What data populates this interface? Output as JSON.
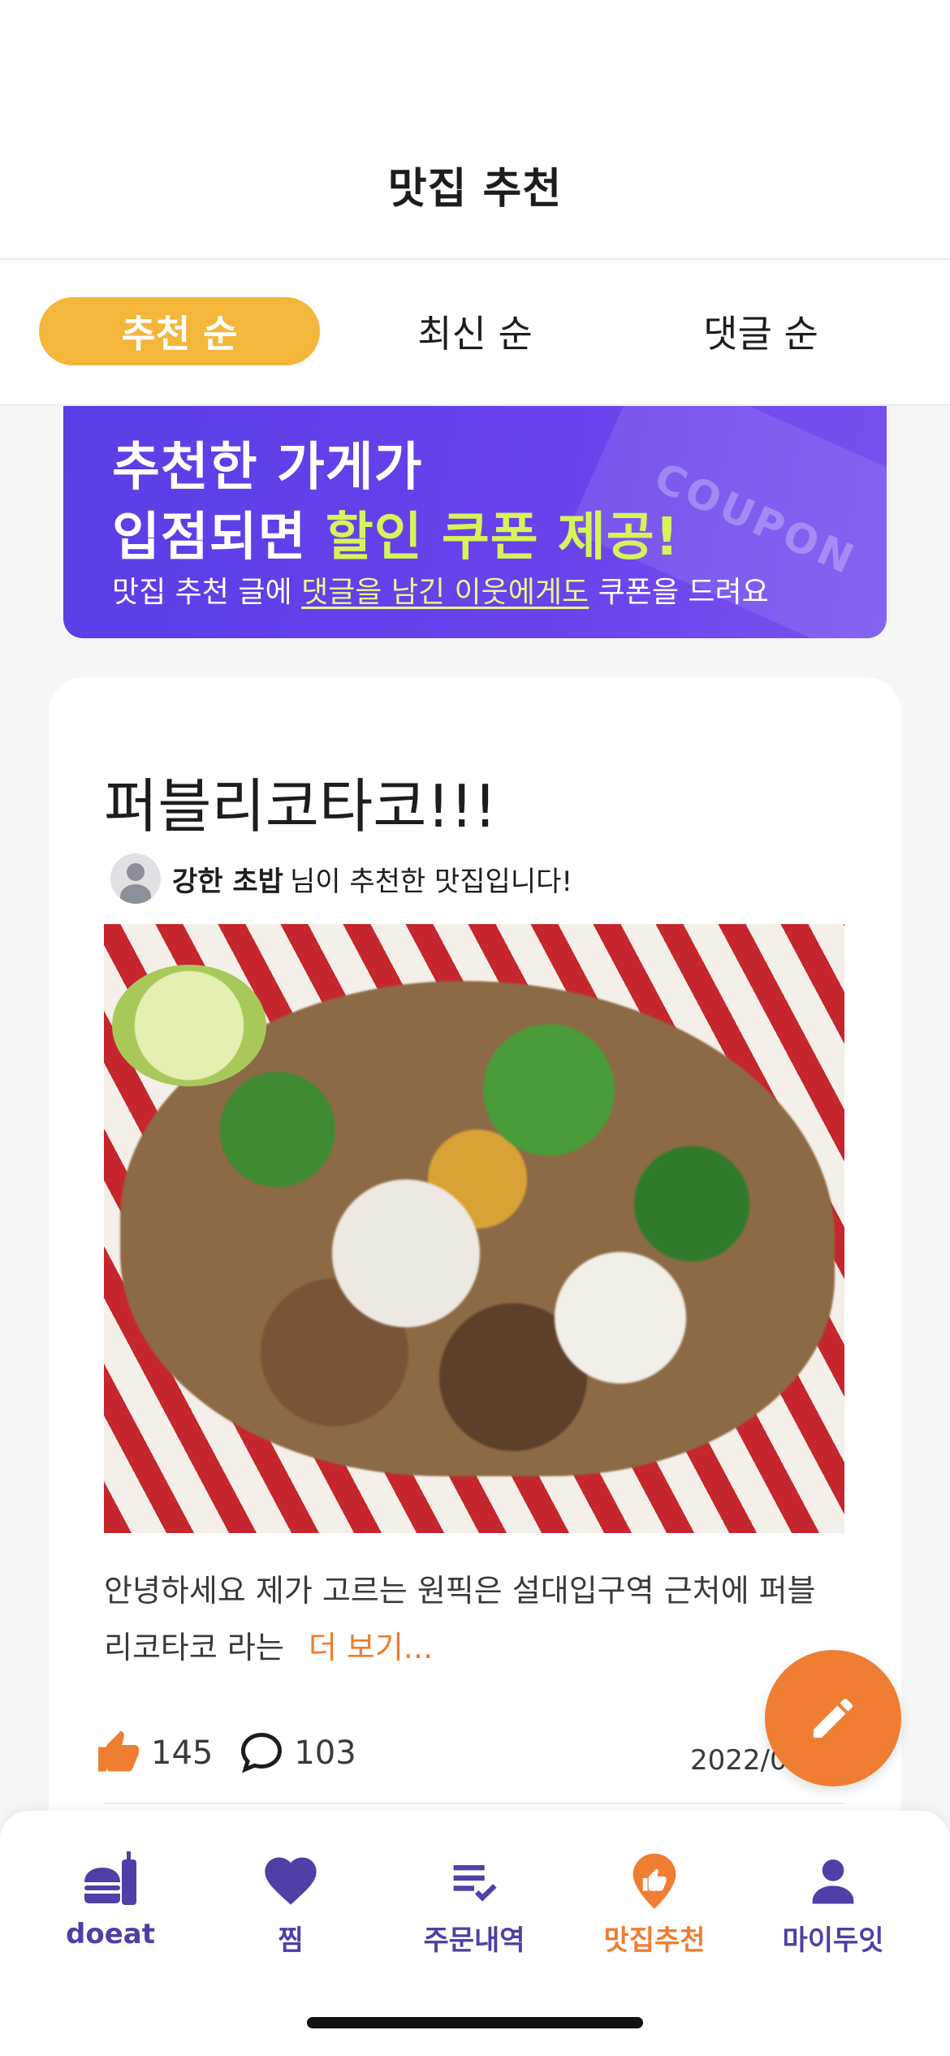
{
  "header": {
    "title": "맛집 추천"
  },
  "sort_tabs": [
    {
      "label": "추천 순",
      "active": true
    },
    {
      "label": "최신 순",
      "active": false
    },
    {
      "label": "댓글 순",
      "active": false
    }
  ],
  "banner": {
    "line1": "추천한 가게가",
    "line2_prefix": "입점되면 ",
    "line2_highlight": "할인 쿠폰 제공!",
    "line3_prefix": "맛집 추천 글에 ",
    "line3_underline": "댓글을 남긴 이웃에게도",
    "line3_suffix": " 쿠폰을 드려요",
    "coupon_word": "COUPON",
    "colors": {
      "background": "#5b3de6",
      "highlight": "#d7f35a"
    }
  },
  "post": {
    "title": "퍼블리코타코!!!",
    "author_name": "강한 초밥",
    "author_suffix": "님이 추천한 맛집입니다!",
    "excerpt_line1": "안녕하세요    제가 고르는 원픽은 설대입구역 근처에 퍼블",
    "excerpt_line2": "리코타코 라는",
    "more_label": "더 보기...",
    "likes": "145",
    "comments": "103",
    "date": "2022/0",
    "photo_icon": "food-photo"
  },
  "fab": {
    "icon": "pencil-icon",
    "color": "#ef7e33"
  },
  "bottom_nav": [
    {
      "label": "doeat",
      "icon": "burger-drink-icon",
      "active": false
    },
    {
      "label": "찜",
      "icon": "heart-icon",
      "active": false
    },
    {
      "label": "주문내역",
      "icon": "order-list-icon",
      "active": false
    },
    {
      "label": "맛집추천",
      "icon": "thumb-up-pin-icon",
      "active": true
    },
    {
      "label": "마이두잇",
      "icon": "person-icon",
      "active": false
    }
  ],
  "colors": {
    "accent_orange": "#ef7e33",
    "tab_yellow": "#f4b73b",
    "nav_purple": "#4f3fa6"
  }
}
